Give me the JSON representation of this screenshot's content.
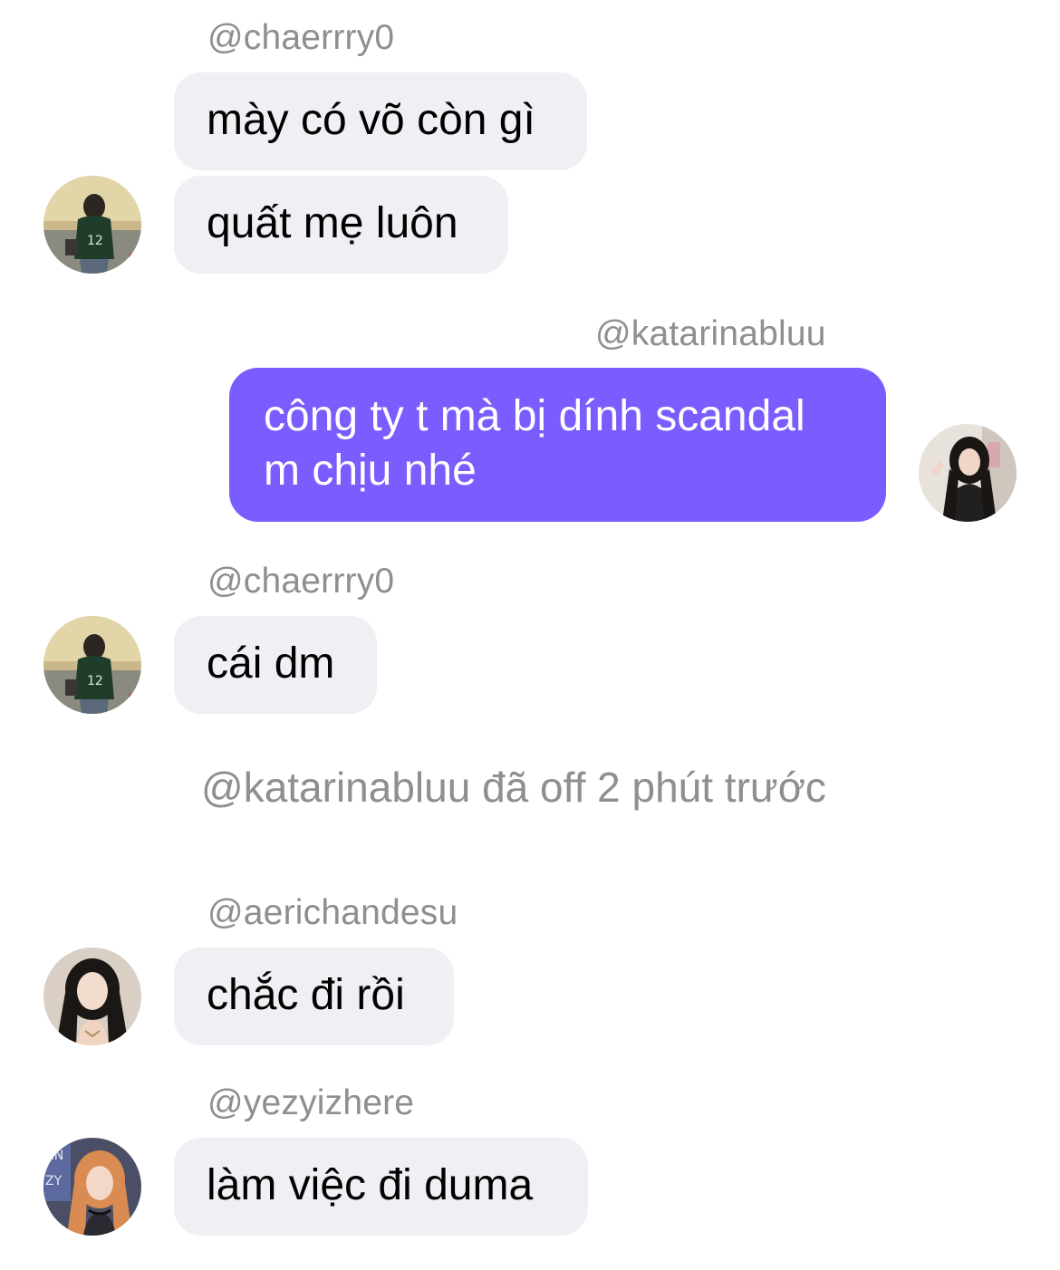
{
  "messages": [
    {
      "username": "@chaerrry0",
      "lines": [
        "mày có võ còn gì",
        "quất mẹ luôn"
      ]
    },
    {
      "username": "@katarinabluu",
      "text": "công ty t mà bị dính scandal m chịu nhé"
    },
    {
      "username": "@chaerrry0",
      "text": "cái dm"
    },
    {
      "status": "@katarinabluu đã off 2 phút trước"
    },
    {
      "username": "@aerichandesu",
      "text": "chắc đi rồi"
    },
    {
      "username": "@yezyizhere",
      "text": "làm việc đi duma"
    }
  ],
  "colors": {
    "incoming_bubble": "#efeff4",
    "outgoing_bubble": "#7a5cff",
    "username_gray": "#8e8e93"
  },
  "avatars": [
    "chaerrry0-avatar",
    "katarinabluu-avatar",
    "chaerrry0-avatar",
    "aerichandesu-avatar",
    "yezyizhere-avatar"
  ]
}
